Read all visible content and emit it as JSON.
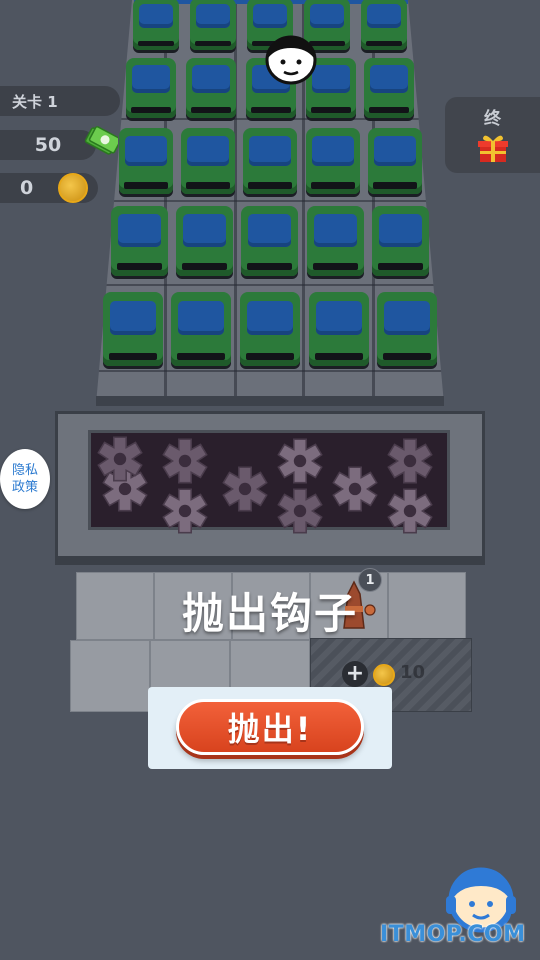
{
  "hud": {
    "level_label": "关卡 1",
    "money_value": "50",
    "coin_value": "0",
    "final_label": "终"
  },
  "privacy": {
    "line1": "隐私",
    "line2": "政策"
  },
  "slots": {
    "hook_label": "抛出钩子",
    "hook_count": "1",
    "unlock_price": "10"
  },
  "actions": {
    "throw_label": "抛出!"
  },
  "watermark": "ITMOP.COM",
  "colors": {
    "background": "#4f5560",
    "car_body": "#2c7a3a",
    "car_roof": "#1f56a0",
    "throw_button": "#e2502c",
    "privacy_text": "#2d7bd0",
    "watermark": "#3a8fd8"
  },
  "icons": [
    "cash-icon",
    "coin-icon",
    "gift-icon",
    "face-icon",
    "plus-icon",
    "hook-icon",
    "support-icon"
  ]
}
